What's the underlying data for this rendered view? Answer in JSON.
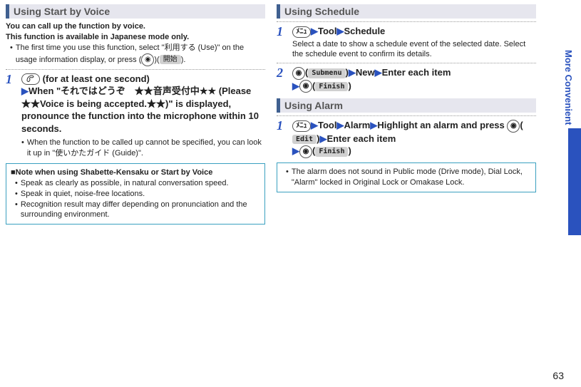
{
  "pageNumber": "63",
  "sideLabel": "More Convenient",
  "left": {
    "header": "Using Start by Voice",
    "intro1": "You can call up the function by voice.",
    "intro2": "This function is available in Japanese mode only.",
    "bullet1_a": "The first time you use this function, select \"",
    "bullet1_jp": "利用する",
    "bullet1_b": " (Use)\" on the usage information display, or press ",
    "bullet1_btn": "開始",
    "bullet1_c": ".",
    "step1_num": "1",
    "step1_a": " (for at least one second)",
    "step1_b": "When \"",
    "step1_jp1": "それではどうぞ",
    "step1_c": "　★★",
    "step1_jp2": "音声受付中",
    "step1_d": "★★ (Please　★★Voice is being accepted.★★)\" is displayed, pronounce the function into the microphone within 10 seconds.",
    "step1_sub_a": "When the function to be called up cannot be specified, you can look it up in \"",
    "step1_sub_jp": "使いかたガイド",
    "step1_sub_b": " (Guide)\".",
    "noteTitle": "Note when using Shabette-Kensaku or Start by Voice",
    "noteB1": "Speak as clearly as possible, in natural conversation speed.",
    "noteB2": "Speak in quiet, noise-free locations.",
    "noteB3": "Recognition result may differ depending on pronunciation and the surrounding environment."
  },
  "right": {
    "schedHeader": "Using Schedule",
    "sched1_num": "1",
    "sched1_tool": "Tool",
    "sched1_schedule": "Schedule",
    "sched1_desc": "Select a date to show a schedule event of the selected date. Select the schedule event to confirm its details.",
    "sched2_num": "2",
    "sched2_submenu": "Submenu",
    "sched2_new": "New",
    "sched2_enter": "Enter each item",
    "sched2_finish": "Finish",
    "alarmHeader": "Using Alarm",
    "alarm1_num": "1",
    "alarm1_tool": "Tool",
    "alarm1_alarm": "Alarm",
    "alarm1_highlight": "Highlight an alarm and press ",
    "alarm1_edit": "Edit",
    "alarm1_enter": "Enter each item",
    "alarm1_finish": "Finish",
    "alarmNote": "The alarm does not sound in Public mode (Drive mode), Dial Lock, \"Alarm\" locked in Original Lock or Omakase Lock."
  },
  "icons": {
    "menu": "ﾒﾆｭ",
    "camera": "◉",
    "phone": "✆"
  }
}
